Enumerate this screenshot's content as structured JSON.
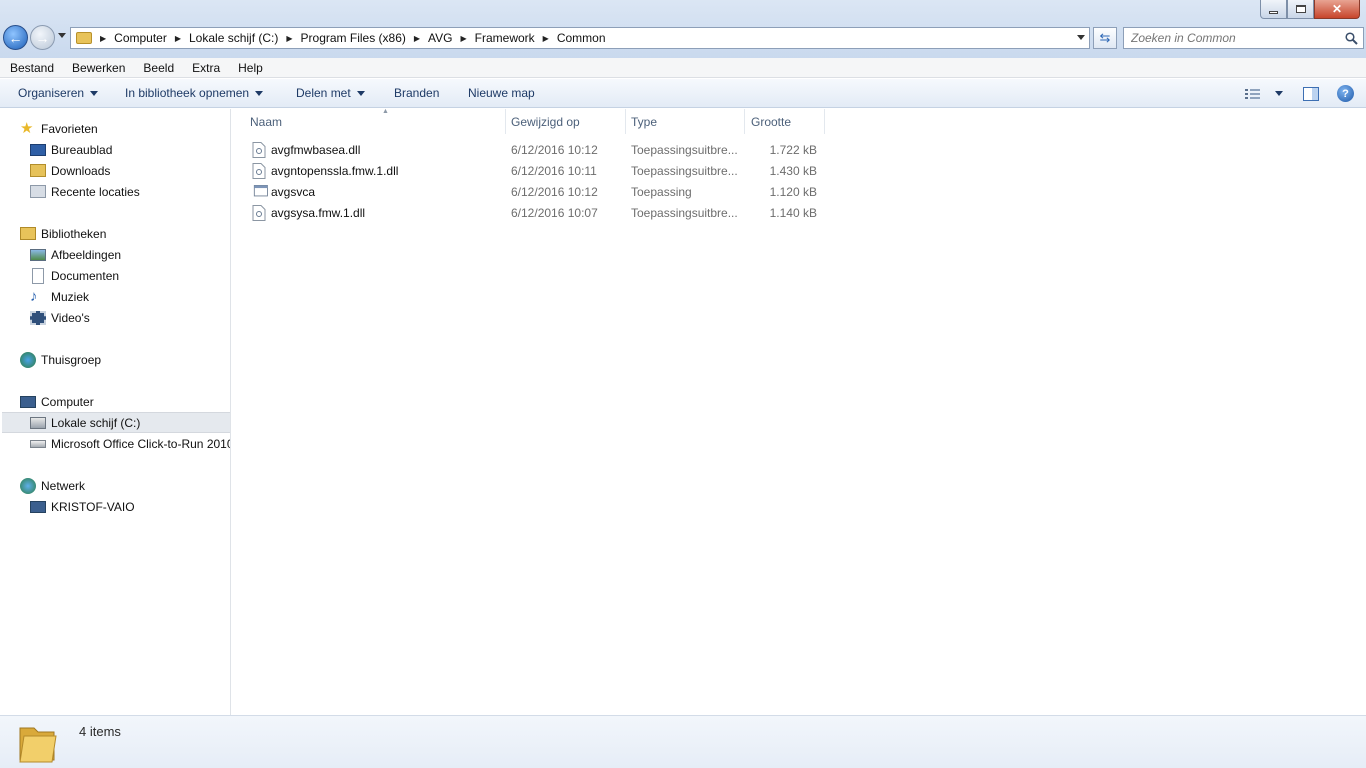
{
  "window": {
    "controls": {
      "minimize": "minimize-icon",
      "maximize": "maximize-icon",
      "close": "close-icon"
    }
  },
  "address": {
    "crumbs": [
      "Computer",
      "Lokale schijf (C:)",
      "Program Files (x86)",
      "AVG",
      "Framework",
      "Common"
    ]
  },
  "search": {
    "placeholder": "Zoeken in Common"
  },
  "menu": {
    "items": [
      "Bestand",
      "Bewerken",
      "Beeld",
      "Extra",
      "Help"
    ]
  },
  "toolbar": {
    "organize": "Organiseren",
    "include_library": "In bibliotheek opnemen",
    "share": "Delen met",
    "burn": "Branden",
    "new_folder": "Nieuwe map"
  },
  "nav": {
    "favorites": {
      "label": "Favorieten",
      "items": [
        "Bureaublad",
        "Downloads",
        "Recente locaties"
      ]
    },
    "libraries": {
      "label": "Bibliotheken",
      "items": [
        "Afbeeldingen",
        "Documenten",
        "Muziek",
        "Video's"
      ]
    },
    "homegroup": {
      "label": "Thuisgroep"
    },
    "computer": {
      "label": "Computer",
      "items": [
        "Lokale schijf (C:)",
        "Microsoft Office Click-to-Run 2010"
      ]
    },
    "network": {
      "label": "Netwerk",
      "items": [
        "KRISTOF-VAIO"
      ]
    }
  },
  "columns": {
    "name": "Naam",
    "modified": "Gewijzigd op",
    "type": "Type",
    "size": "Grootte"
  },
  "files": [
    {
      "name": "avgfmwbasea.dll",
      "modified": "6/12/2016 10:12",
      "type": "Toepassingsuitbre...",
      "size": "1.722 kB",
      "icon": "dll-file-icon"
    },
    {
      "name": "avgntopenssla.fmw.1.dll",
      "modified": "6/12/2016 10:11",
      "type": "Toepassingsuitbre...",
      "size": "1.430 kB",
      "icon": "dll-file-icon"
    },
    {
      "name": "avgsvca",
      "modified": "6/12/2016 10:12",
      "type": "Toepassing",
      "size": "1.120 kB",
      "icon": "application-icon"
    },
    {
      "name": "avgsysa.fmw.1.dll",
      "modified": "6/12/2016 10:07",
      "type": "Toepassingsuitbre...",
      "size": "1.140 kB",
      "icon": "dll-file-icon"
    }
  ],
  "status": {
    "item_count": "4 items"
  }
}
